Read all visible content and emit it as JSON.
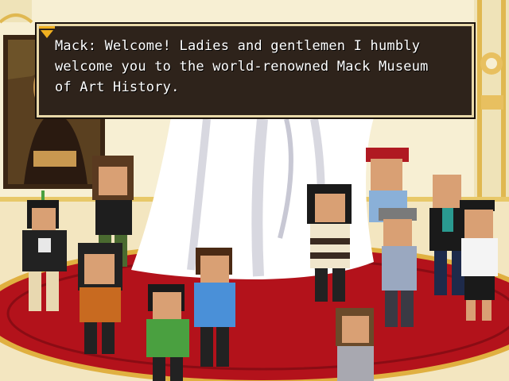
{
  "dialog": {
    "speaker": "Mack",
    "text": "Mack: Welcome! Ladies and gentlemen I humbly welcome you to the world-renowned Mack Museum of Art History."
  },
  "colors": {
    "wall": "#f6eed0",
    "carpet": "#b3121b",
    "carpet_trim": "#e0b040",
    "dialog_bg": "#2e231b",
    "dialog_border": "#e8d8a8",
    "advance_arrow": "#f0b020"
  },
  "icons": {
    "advance": "advance-arrow-icon"
  }
}
